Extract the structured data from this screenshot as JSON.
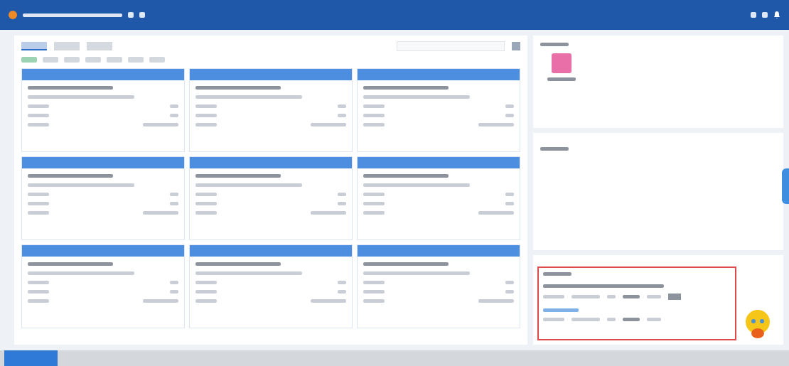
{
  "tabs": [
    {
      "selected": true
    },
    {
      "selected": false
    },
    {
      "selected": false
    }
  ],
  "filters": [
    {
      "selected": true
    },
    {
      "selected": false
    },
    {
      "selected": false
    },
    {
      "selected": false
    },
    {
      "selected": false
    },
    {
      "selected": false
    },
    {
      "selected": false
    }
  ],
  "cards": [
    {
      "kind": "order"
    },
    {
      "kind": "order"
    },
    {
      "kind": "order"
    },
    {
      "kind": "order"
    },
    {
      "kind": "order"
    },
    {
      "kind": "order"
    },
    {
      "kind": "order"
    },
    {
      "kind": "order"
    },
    {
      "kind": "order"
    }
  ],
  "messages": [
    {
      "kind": "with-action"
    },
    {
      "kind": "plain"
    }
  ]
}
